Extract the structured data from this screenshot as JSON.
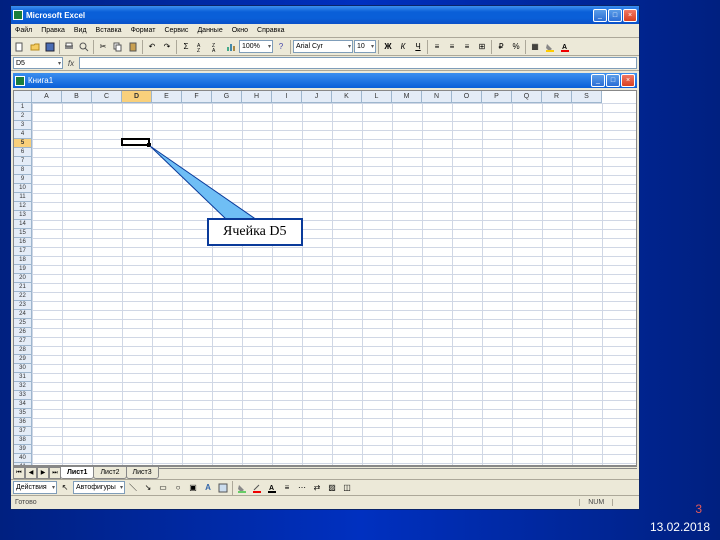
{
  "window": {
    "title": "Microsoft Excel"
  },
  "menu": [
    "Файл",
    "Правка",
    "Вид",
    "Вставка",
    "Формат",
    "Сервис",
    "Данные",
    "Окно",
    "Справка"
  ],
  "toolbar1": {
    "zoom": "100%",
    "font": "Arial Cyr",
    "font_size": "10"
  },
  "name_box": "D5",
  "doc": {
    "title": "Книга1"
  },
  "columns": [
    "A",
    "B",
    "C",
    "D",
    "E",
    "F",
    "G",
    "H",
    "I",
    "J",
    "K",
    "L",
    "M",
    "N",
    "O",
    "P",
    "Q",
    "R",
    "S"
  ],
  "row_count": 45,
  "active": {
    "col": 3,
    "row": 4
  },
  "callout": {
    "text": "Ячейка D5"
  },
  "sheets": {
    "tabs": [
      "Лист1",
      "Лист2",
      "Лист3"
    ],
    "active": 0
  },
  "drawing_bar": {
    "label": "Действия",
    "autoshapes": "Автофигуры"
  },
  "status": {
    "ready": "Готово",
    "num": "NUM"
  },
  "slide": {
    "num": "3",
    "date": "13.02.2018"
  }
}
